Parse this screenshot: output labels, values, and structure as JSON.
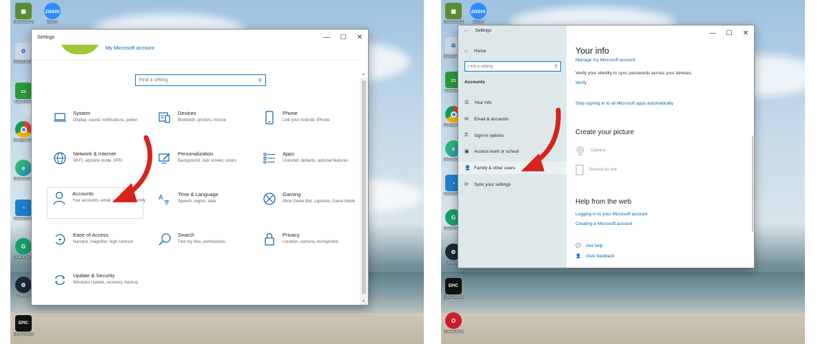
{
  "left": {
    "window": {
      "title": "Settings",
      "minimize_label": "—",
      "maximize_label": "☐",
      "close_label": "✕"
    },
    "account": {
      "link_text": "My Microsoft account"
    },
    "search": {
      "placeholder": "Find a setting"
    },
    "categories": [
      {
        "name": "System",
        "desc": "Display, sound, notifications, power",
        "icon": "laptop-icon"
      },
      {
        "name": "Devices",
        "desc": "Bluetooth, printers, mouse",
        "icon": "keyboard-icon"
      },
      {
        "name": "Phone",
        "desc": "Link your Android, iPhone",
        "icon": "phone-icon"
      },
      {
        "name": "Network & Internet",
        "desc": "Wi-Fi, airplane mode, VPN",
        "icon": "globe-icon"
      },
      {
        "name": "Personalization",
        "desc": "Background, lock screen, colors",
        "icon": "paint-icon"
      },
      {
        "name": "Apps",
        "desc": "Uninstall, defaults, optional features",
        "icon": "apps-icon"
      },
      {
        "name": "Accounts",
        "desc": "Your accounts, email, sync, work, family",
        "icon": "person-icon"
      },
      {
        "name": "Time & Language",
        "desc": "Speech, region, date",
        "icon": "time-language-icon"
      },
      {
        "name": "Gaming",
        "desc": "Xbox Game Bar, captures, Game Mode",
        "icon": "xbox-icon"
      },
      {
        "name": "Ease of Access",
        "desc": "Narrator, magnifier, high contrast",
        "icon": "ease-of-access-icon"
      },
      {
        "name": "Search",
        "desc": "Find my files, permissions",
        "icon": "search-icon"
      },
      {
        "name": "Privacy",
        "desc": "Location, camera, microphone",
        "icon": "lock-icon"
      },
      {
        "name": "Update & Security",
        "desc": "Windows Update, recovery, backup",
        "icon": "update-icon"
      }
    ],
    "desktop_icons": [
      {
        "label": "Minecraft Launcher",
        "icon": "minecraft-icon",
        "color": "#5b8c32"
      },
      {
        "label": "Zoom",
        "icon": "zoom-icon",
        "color": "#2d8cff"
      },
      {
        "label": "Recycle Bin",
        "icon": "recycle-bin-icon",
        "color": "#c9d6e3"
      },
      {
        "label": "Camtasia",
        "icon": "camtasia-icon",
        "color": "#2a9a3a"
      },
      {
        "label": "Google Chrome",
        "icon": "chrome-icon",
        "color": "#db4437"
      },
      {
        "label": "Microsoft Edge",
        "icon": "edge-icon",
        "color": "#1e90c8"
      },
      {
        "label": "GlassWire",
        "icon": "glasswire-icon",
        "color": "#1f7fcf"
      },
      {
        "label": "Grammarly",
        "icon": "grammarly-icon",
        "color": "#15a06b"
      },
      {
        "label": "Steam",
        "icon": "steam-icon",
        "color": "#1b2838"
      },
      {
        "label": "Epic Games",
        "icon": "epic-games-icon",
        "color": "#111111"
      }
    ]
  },
  "right": {
    "window": {
      "title": "Settings",
      "back_label": "←",
      "minimize_label": "—",
      "maximize_label": "☐",
      "close_label": "✕"
    },
    "sidebar": {
      "home_label": "Home",
      "search_placeholder": "Find a setting",
      "heading": "Accounts",
      "items": [
        {
          "label": "Your info",
          "icon": "your-info-icon"
        },
        {
          "label": "Email & accounts",
          "icon": "email-icon"
        },
        {
          "label": "Sign-in options",
          "icon": "key-icon"
        },
        {
          "label": "Access work or school",
          "icon": "briefcase-icon"
        },
        {
          "label": "Family & other users",
          "icon": "family-icon"
        },
        {
          "label": "Sync your settings",
          "icon": "sync-icon"
        }
      ]
    },
    "content": {
      "title": "Your info",
      "manage_link": "Manage my Microsoft account",
      "verify_text": "Verify your identity to sync passwords across your devices.",
      "verify_link": "Verify",
      "stop_link": "Stop signing in to all Microsoft apps automatically",
      "picture_heading": "Create your picture",
      "camera_label": "Camera",
      "browse_label": "Browse for one",
      "help_heading": "Help from the web",
      "help_link_1": "Logging in to your Microsoft account",
      "help_link_2": "Creating a Microsoft account",
      "get_help": "Get help",
      "give_feedback": "Give feedback"
    },
    "desktop_icons": [
      {
        "label": "Minecraft Launcher",
        "icon": "minecraft-icon",
        "color": "#5b8c32"
      },
      {
        "label": "Zoom",
        "icon": "zoom-icon",
        "color": "#2d8cff"
      },
      {
        "label": "Recycle Bin",
        "icon": "recycle-bin-icon",
        "color": "#c9d6e3"
      },
      {
        "label": "Camtasia",
        "icon": "camtasia-icon",
        "color": "#2a9a3a"
      },
      {
        "label": "Google Chrome",
        "icon": "chrome-icon",
        "color": "#db4437"
      },
      {
        "label": "Microsoft Edge",
        "icon": "edge-icon",
        "color": "#1e90c8"
      },
      {
        "label": "GlassWire",
        "icon": "glasswire-icon",
        "color": "#1f7fcf"
      },
      {
        "label": "Grammarly",
        "icon": "grammarly-icon",
        "color": "#15a06b"
      },
      {
        "label": "Steam",
        "icon": "steam-icon",
        "color": "#1b2838"
      },
      {
        "label": "Epic Games",
        "icon": "epic-games-icon",
        "color": "#111111"
      },
      {
        "label": "Opera Browser",
        "icon": "opera-icon",
        "color": "#cc1b2b"
      }
    ]
  },
  "colors": {
    "accent": "#0078d7",
    "link": "#0066b4",
    "arrow": "#d8231a",
    "avatar": "#a4c639"
  }
}
